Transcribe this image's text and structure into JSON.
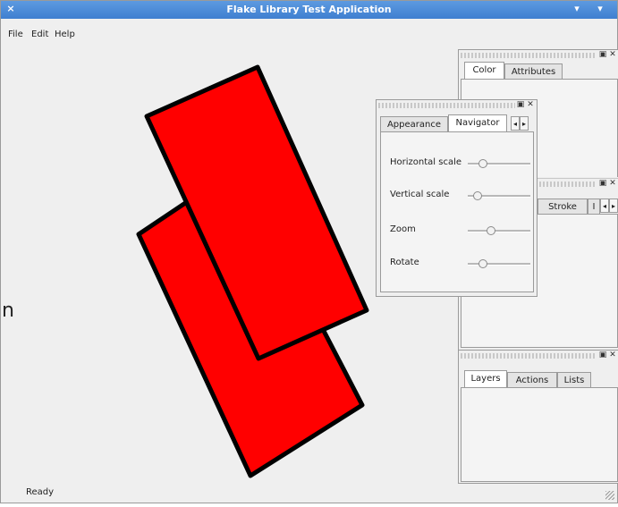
{
  "window": {
    "title": "Flake Library Test Application",
    "close_glyph": "×",
    "minimize_glyph": "▾",
    "menu_glyph": "▾"
  },
  "menu": [
    "File",
    "Edit",
    "Help"
  ],
  "status": "Ready",
  "canvas_cutoff_text": "n",
  "colors": {
    "shape_fill": "#ff0000",
    "shape_stroke": "#000000",
    "titlebar": "#4a89d8"
  },
  "docks": {
    "color_dock": {
      "tabs": [
        "Color",
        "Attributes"
      ],
      "active": "Color"
    },
    "stroke_dock": {
      "tabs": [
        "Stroke",
        "I"
      ]
    },
    "navigator_dock": {
      "tabs": [
        "Appearance",
        "Navigator"
      ],
      "active": "Navigator",
      "controls": [
        {
          "label": "Horizontal scale",
          "value": 0.2
        },
        {
          "label": "Vertical scale",
          "value": 0.1
        },
        {
          "label": "Zoom",
          "value": 0.35
        },
        {
          "label": "Rotate",
          "value": 0.2
        }
      ]
    },
    "layers_dock": {
      "tabs": [
        "Layers",
        "Actions",
        "Lists"
      ],
      "active": "Layers"
    }
  },
  "dock_buttons": {
    "float": "▣",
    "close": "✕"
  },
  "tab_arrows": {
    "left": "◂",
    "right": "▸"
  }
}
